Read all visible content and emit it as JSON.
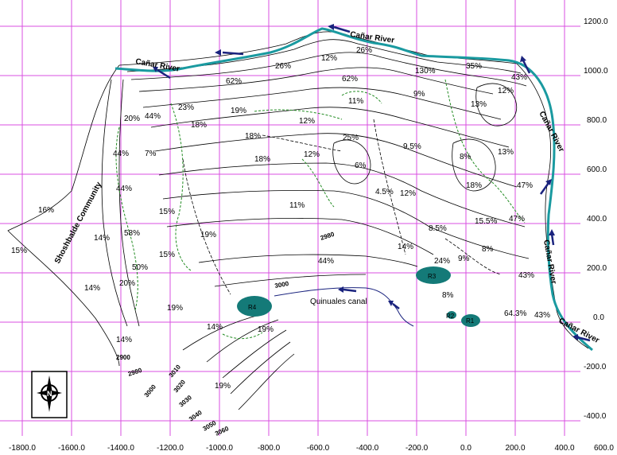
{
  "x_ticks": [
    "-1800.0",
    "-1600.0",
    "-1400.0",
    "-1200.0",
    "-1000.0",
    "-800.0",
    "-600.0",
    "-400.0",
    "-200.0",
    "0.0",
    "200.0",
    "400.0",
    "600.0"
  ],
  "y_ticks": [
    "1200.0",
    "1000.0",
    "800.0",
    "600.0",
    "400.0",
    "200.0",
    "0.0",
    "-200.0",
    "-400.0"
  ],
  "rivers": [
    "Cañar River",
    "Cañar River",
    "Cañar River",
    "Cañar River",
    "Cañar River"
  ],
  "community": "Shoshbalde Community",
  "canal": "Quinuales canal",
  "reservoirs": [
    "R4",
    "R3",
    "R2",
    "R1"
  ],
  "contours": [
    "2980",
    "3000",
    "2900",
    "2980",
    "3010",
    "3000",
    "3020",
    "3030",
    "3040",
    "3050",
    "3060"
  ],
  "slopes": [
    "26%",
    "12%",
    "26%",
    "35%",
    "43%",
    "62%",
    "62%",
    "130%",
    "9%",
    "12%",
    "23%",
    "44%",
    "19%",
    "11%",
    "13%",
    "20%",
    "18%",
    "12%",
    "18%",
    "25%",
    "9.5%",
    "8%",
    "13%",
    "44%",
    "7%",
    "18%",
    "12%",
    "6%",
    "4.5%",
    "12%",
    "18%",
    "47%",
    "44%",
    "16%",
    "15%",
    "11%",
    "47%",
    "15.5%",
    "8.5%",
    "14%",
    "58%",
    "19%",
    "15%",
    "8%",
    "14%",
    "15%",
    "44%",
    "24%",
    "9%",
    "50%",
    "43%",
    "20%",
    "14%",
    "19%",
    "8%",
    "14%",
    "19%",
    "64.3%",
    "43%",
    "14%",
    "19%"
  ],
  "north": "N",
  "colors": {
    "grid": "#d84fe0",
    "river": "#1a9aa0",
    "reservoir": "#147a78",
    "arrow": "#1a237e",
    "dashed": "#228b22"
  }
}
